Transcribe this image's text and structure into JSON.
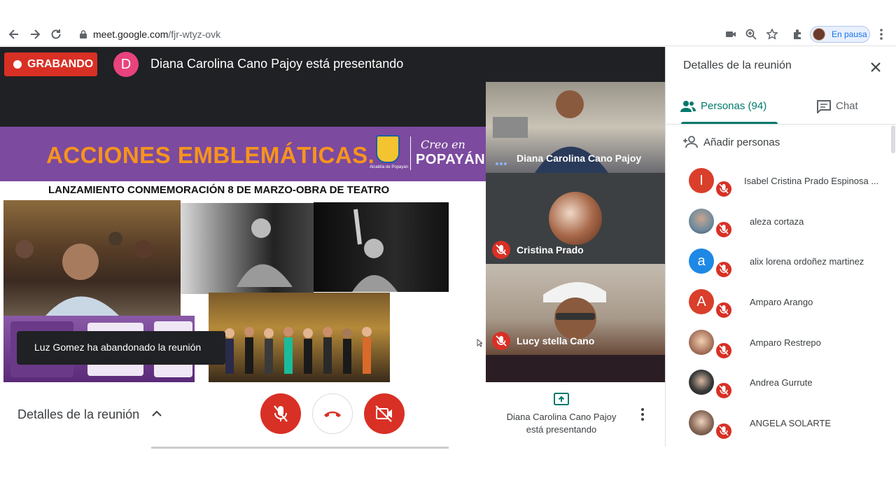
{
  "browser": {
    "url_host": "meet.google.com",
    "url_path": "/fjr-wtyz-ovk",
    "profile_status": "En pausa"
  },
  "meeting": {
    "recording_label": "GRABANDO",
    "presenter_initial": "D",
    "presenter_banner": "Diana Carolina Cano Pajoy está presentando",
    "slide_heading": "ACCIONES EMBLEMÁTICAS.",
    "slide_logo_caption": "Alcaldía de Popayán",
    "slide_logo_top": "Creo en",
    "slide_logo_bottom": "POPAYÁN",
    "slide_subtitle": "LANZAMIENTO CONMEMORACIÓN 8 DE MARZO-OBRA DE TEATRO"
  },
  "tiles": [
    {
      "name": "Diana Carolina Cano Pajoy"
    },
    {
      "name": "Cristina Prado"
    },
    {
      "name": "Lucy stella Cano"
    }
  ],
  "toast": "Luz Gomez ha abandonado la reunión",
  "controls": {
    "details_label": "Detalles de la reunión",
    "presenting_line1": "Diana Carolina Cano Pajoy",
    "presenting_line2": "está presentando"
  },
  "panel": {
    "title": "Detalles de la reunión",
    "tab_people": "Personas (94)",
    "tab_chat": "Chat",
    "add_people": "Añadir personas",
    "people": [
      {
        "name": "Isabel Cristina Prado Espinosa ...",
        "initial": "I",
        "color": "#d93f2b"
      },
      {
        "name": "aleza cortaza",
        "initial": "",
        "color": "#6d8a9c"
      },
      {
        "name": "alix lorena ordoñez martinez",
        "initial": "a",
        "color": "#1e88e5"
      },
      {
        "name": "Amparo Arango",
        "initial": "A",
        "color": "#d93f2b"
      },
      {
        "name": "Amparo Restrepo",
        "initial": "",
        "color": "#b5836a"
      },
      {
        "name": "Andrea Gurrute",
        "initial": "",
        "color": "#3b3b3b"
      },
      {
        "name": "ANGELA SOLARTE",
        "initial": "",
        "color": "#8a6b5a"
      }
    ]
  },
  "colors": {
    "record_red": "#d93025",
    "accent_teal": "#00796b",
    "banner_purple": "#7c4a9e",
    "heading_orange": "#f7941d"
  }
}
